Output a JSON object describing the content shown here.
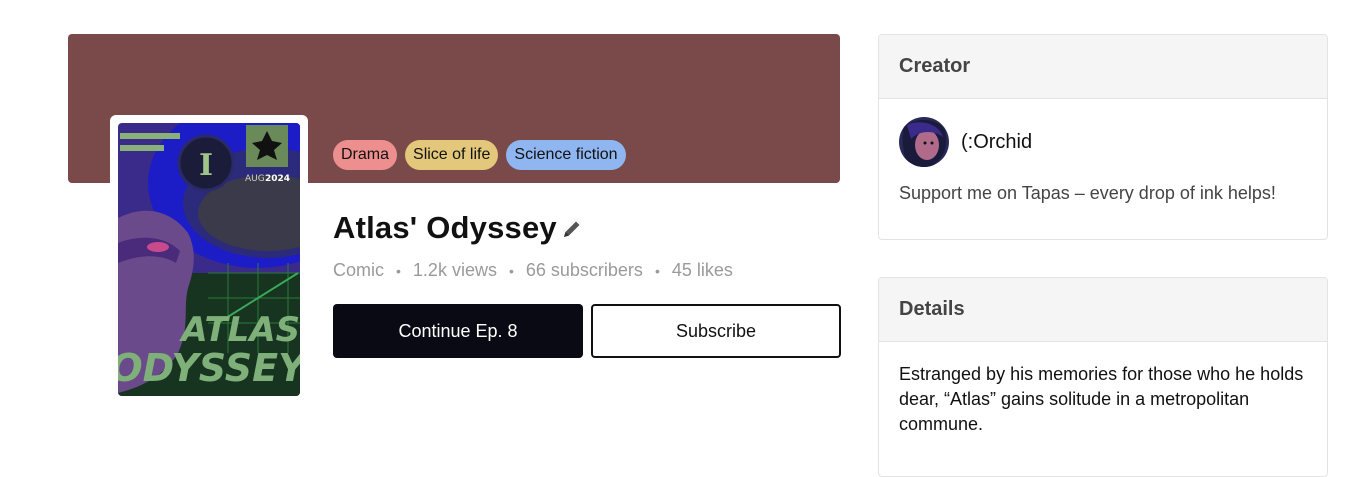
{
  "series": {
    "title": "Atlas' Odyssey",
    "tags": [
      {
        "label": "Drama",
        "color": "#ee8f8f"
      },
      {
        "label": "Slice of life",
        "color": "#e3c77a"
      },
      {
        "label": "Science fiction",
        "color": "#8fb6f0"
      }
    ],
    "stats": {
      "type": "Comic",
      "views": "1.2k views",
      "subscribers": "66 subscribers",
      "likes": "45 likes"
    },
    "banner_color": "#7a4a4a"
  },
  "cover": {
    "issue_number": "I",
    "date_prefix": "AUG",
    "date_year": "2024",
    "title_line1": "ATLAS'",
    "title_line2": "ODYSSEY"
  },
  "actions": {
    "continue_label": "Continue Ep. 8",
    "subscribe_label": "Subscribe"
  },
  "creator_card": {
    "heading": "Creator",
    "name": "(:Orchid",
    "message": "Support me on Tapas – every drop of ink helps!"
  },
  "details_card": {
    "heading": "Details",
    "description": "Estranged by his memories for those who he holds dear, “Atlas” gains solitude in a metropolitan commune."
  }
}
